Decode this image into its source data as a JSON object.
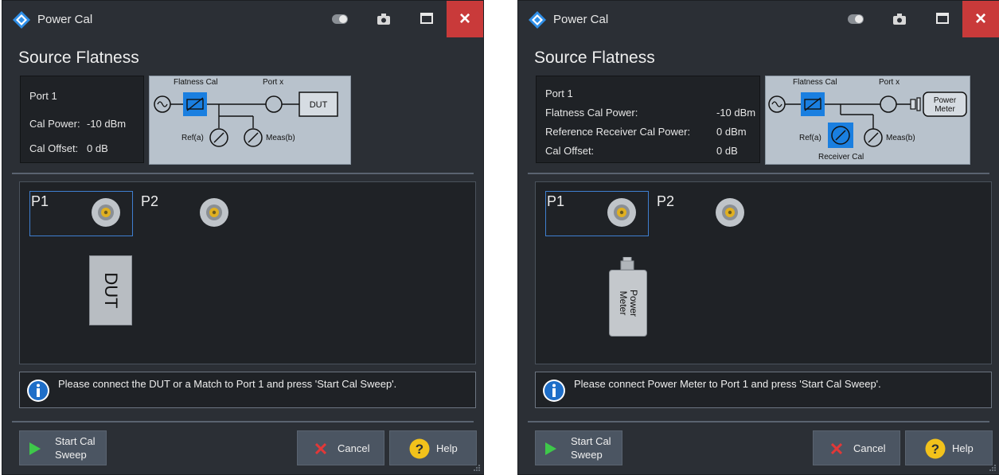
{
  "colors": {
    "window_bg": "#2b2f35",
    "panel_bg": "#1f2226",
    "close_red": "#c93a3a",
    "highlight_blue": "#1a7fe0",
    "diagram_bg": "#b8c2cc",
    "start_green": "#3ec84a",
    "cancel_red": "#e23838",
    "help_yellow": "#f2c21b",
    "info_blue": "#1e6ec8"
  },
  "windows": [
    {
      "title": "Power Cal",
      "close_glyph": "×",
      "heading": "Source Flatness",
      "info": [
        {
          "label": "Port 1",
          "value": ""
        },
        {
          "label": "Cal Power:",
          "value": "-10 dBm"
        },
        {
          "label": "Cal Offset:",
          "value": "0 dB"
        }
      ],
      "diagram": {
        "flatness_cal": "Flatness Cal",
        "port_x": "Port x",
        "target": "DUT",
        "ref": "Ref(a)",
        "meas": "Meas(b)",
        "receiver_cal": ""
      },
      "ports": {
        "p1": "P1",
        "p2": "P2"
      },
      "device": "DUT",
      "message": "Please connect the DUT or a Match to Port 1 and press 'Start Cal Sweep'.",
      "buttons": {
        "start_line1": "Start Cal",
        "start_line2": "Sweep",
        "cancel": "Cancel",
        "help": "Help"
      }
    },
    {
      "title": "Power Cal",
      "close_glyph": "×",
      "heading": "Source Flatness",
      "info": [
        {
          "label": "Port 1",
          "value": ""
        },
        {
          "label": "Flatness Cal Power:",
          "value": "-10 dBm"
        },
        {
          "label": "Reference Receiver Cal Power:",
          "value": "0 dBm"
        },
        {
          "label": "Cal Offset:",
          "value": "0 dB"
        }
      ],
      "diagram": {
        "flatness_cal": "Flatness Cal",
        "port_x": "Port x",
        "target_line1": "Power",
        "target_line2": "Meter",
        "ref": "Ref(a)",
        "meas": "Meas(b)",
        "receiver_cal": "Receiver Cal"
      },
      "ports": {
        "p1": "P1",
        "p2": "P2"
      },
      "device_line1": "Power",
      "device_line2": "Meter",
      "message": "Please connect Power Meter to Port 1 and press 'Start Cal Sweep'.",
      "buttons": {
        "start_line1": "Start Cal",
        "start_line2": "Sweep",
        "cancel": "Cancel",
        "help": "Help"
      }
    }
  ]
}
